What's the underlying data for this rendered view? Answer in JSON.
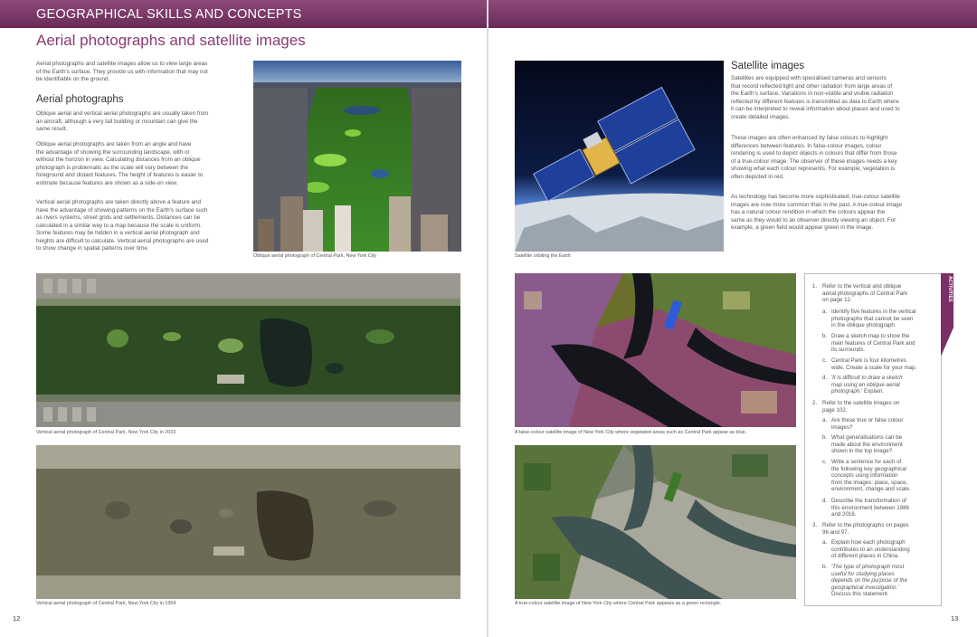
{
  "header": {
    "section_title": "GEOGRAPHICAL SKILLS AND CONCEPTS"
  },
  "left_page": {
    "title": "Aerial photographs and satellite images",
    "intro": [
      "Aerial photographs and satellite images allow us to view large areas",
      "of the Earth's surface. They provide us with information that may not",
      "be identifiable on the ground."
    ],
    "aerial_heading": "Aerial photographs",
    "para1": [
      "Oblique aerial and vertical aerial photographs are usually taken from",
      "an aircraft, although a very tall building or mountain can give the",
      "same result."
    ],
    "para2": [
      "Oblique aerial photographs are taken from an angle and have",
      "the advantage of showing the surrounding landscape, with or",
      "without the horizon in view. Calculating distances from an oblique",
      "photograph is problematic as the scale will vary between the",
      "foreground and distant features. The height of features is easier to",
      "estimate because features are shown as a side-on view."
    ],
    "para3": [
      "Vertical aerial photographs are taken directly above a feature and",
      "have the advantage of showing patterns on the Earth's surface such",
      "as rivers systems, street grids and settlements. Distances can be",
      "calculated in a similar way to a map because the scale is uniform.",
      "Some features may be hidden in a vertical aerial photograph and",
      "heights are difficult to calculate. Vertical aerial photographs are used",
      "to show change in spatial patterns over time."
    ],
    "caption_oblique": "Oblique aerial photograph of Central Park, New York City",
    "caption_vertical_2016": "Vertical aerial photograph of Central Park, New York City in 2016",
    "caption_vertical_1954": "Vertical aerial photograph of Central Park, New York City in 1954",
    "page_number": "12"
  },
  "right_page": {
    "satellite_heading": "Satellite images",
    "para1": [
      "Satellites are equipped with specialised cameras and sensors",
      "that record reflected light and other radiation from large areas of",
      "the Earth's surface. Variations in non-visible and visible radiation",
      "reflected by different features is transmitted as data to Earth where",
      "it can be interpreted to reveal information about places and used to",
      "create detailed images."
    ],
    "para2": [
      "These images are often enhanced by false colours to highlight",
      "differences between features. In false-colour images, colour",
      "rendering is used to depict objects in colours that differ from those",
      "of a true-colour image. The observer of these images needs a key",
      "showing what each colour represents. For example, vegetation is",
      "often depicted in red."
    ],
    "para3": [
      "As technology has become more sophisticated, true-colour satellite",
      "images are now more common than in the past. A true-colour image",
      "has a natural colour rendition in which the colours appear the",
      "same as they would to an observer directly viewing an object. For",
      "example, a green field would appear green in the image."
    ],
    "caption_satellite": "Satellite orbiting the Earth",
    "caption_false_colour": "A false-colour satellite image of New York City where vegetated areas such as Central Park appear as blue.",
    "caption_true_colour": "A true-colour satellite image of New York City where Central Park appears as a green rectangle.",
    "page_number": "13"
  },
  "activities": {
    "tab_label": "ACTIVITIES",
    "q1": {
      "num": "1.",
      "lines": [
        "Refer to the vertical and oblique",
        "aerial photographs of Central Park",
        "on page 12."
      ]
    },
    "q1a": {
      "letter": "a.",
      "lines": [
        "Identify five features in the vertical",
        "photographs that cannot be seen",
        "in the oblique photograph."
      ]
    },
    "q1b": {
      "letter": "b.",
      "lines": [
        "Draw a sketch map to show the",
        "main features of Central Park and",
        "its surrounds."
      ]
    },
    "q1c": {
      "letter": "c.",
      "lines": [
        "Central Park is four kilometres",
        "wide. Create a scale for your map."
      ]
    },
    "q1d": {
      "letter": "d.",
      "italic_lines": [
        "'It is difficult to draw a sketch",
        "map using an oblique aerial",
        "photograph.'"
      ],
      "tail": "Explain."
    },
    "q2": {
      "num": "2.",
      "lines": [
        "Refer to the satellite images on",
        "page 102."
      ]
    },
    "q2a": {
      "letter": "a.",
      "lines": [
        "Are these true or false colour",
        "images?"
      ]
    },
    "q2b": {
      "letter": "b.",
      "lines": [
        "What generalisations can be",
        "made about the environment",
        "shown in the top image?"
      ]
    },
    "q2c": {
      "letter": "c.",
      "lines": [
        "Write a sentence for each of",
        "the following key geographical",
        "concepts using information",
        "from the images: place, space,",
        "environment, change and scale."
      ]
    },
    "q2d": {
      "letter": "d.",
      "lines": [
        "Describe the transformation of",
        "this environment between 1986",
        "and 2016."
      ]
    },
    "q3": {
      "num": "3.",
      "lines": [
        "Refer to the photographs on pages",
        "96 and 97."
      ]
    },
    "q3a": {
      "letter": "a.",
      "lines": [
        "Explain how each photograph",
        "contributes to an understanding",
        "of different places in China."
      ]
    },
    "q3b": {
      "letter": "b.",
      "italic_lines": [
        "'The type of photograph most",
        "useful for studying places",
        "depends on the purpose of the",
        "geographical investigation.'"
      ],
      "tail": "Discuss this statement."
    }
  }
}
